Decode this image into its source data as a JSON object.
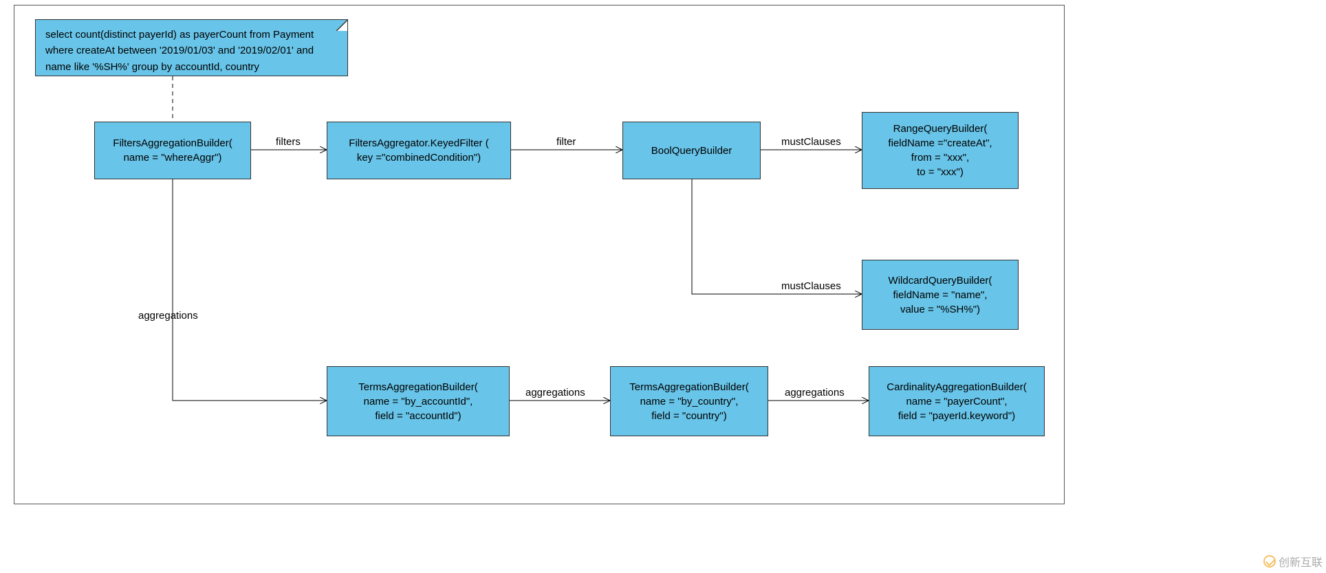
{
  "note": {
    "line1": "select count(distinct payerId) as payerCount from Payment",
    "line2": "where createAt between '2019/01/03' and '2019/02/01' and",
    "line3": "name like '%SH%' group by accountId, country"
  },
  "boxes": {
    "filtersAggBuilder": {
      "line1": "FiltersAggregationBuilder(",
      "line2": "name = \"whereAggr\")"
    },
    "keyedFilter": {
      "line1": "FiltersAggregator.KeyedFilter (",
      "line2": "key =\"combinedCondition\")"
    },
    "boolQueryBuilder": {
      "line1": "BoolQueryBuilder"
    },
    "rangeQueryBuilder": {
      "line1": "RangeQueryBuilder(",
      "line2": "fieldName =\"createAt\",",
      "line3": "from = \"xxx\",",
      "line4": "to = \"xxx\")"
    },
    "wildcardQueryBuilder": {
      "line1": "WildcardQueryBuilder(",
      "line2": "fieldName = \"name\",",
      "line3": "value = \"%SH%\")"
    },
    "termsAccountId": {
      "line1": "TermsAggregationBuilder(",
      "line2": "name = \"by_accountId\",",
      "line3": "field = \"accountId\")"
    },
    "termsCountry": {
      "line1": "TermsAggregationBuilder(",
      "line2": "name = \"by_country\",",
      "line3": "field = \"country\")"
    },
    "cardinalityBuilder": {
      "line1": "CardinalityAggregationBuilder(",
      "line2": "name = \"payerCount\",",
      "line3": "field = \"payerId.keyword\")"
    }
  },
  "edges": {
    "filters": "filters",
    "filter": "filter",
    "mustClauses1": "mustClauses",
    "mustClauses2": "mustClauses",
    "aggregations1": "aggregations",
    "aggregations2": "aggregations",
    "aggregations3": "aggregations"
  },
  "watermark": "创新互联"
}
